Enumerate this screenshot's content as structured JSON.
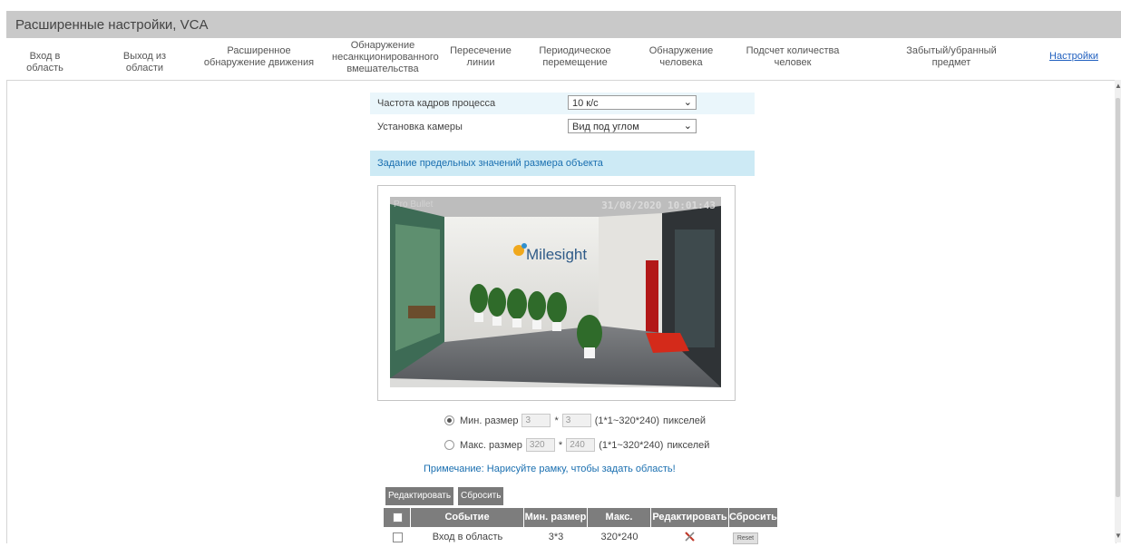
{
  "window": {
    "title": "Расширенные настройки, VCA"
  },
  "tabs": [
    {
      "label": "Вход в область"
    },
    {
      "label": "Выход из области"
    },
    {
      "label": "Расширенное обнаружение движения"
    },
    {
      "label": "Обнаружение несанкционированного вмешательства"
    },
    {
      "label": "Пересечение линии"
    },
    {
      "label": "Периодическое перемещение"
    },
    {
      "label": "Обнаружение человека"
    },
    {
      "label": "Подсчет количества человек"
    },
    {
      "label": "Забытый/убранный предмет"
    },
    {
      "label": "Настройки",
      "active": true
    }
  ],
  "settings": {
    "frame_rate": {
      "label": "Частота кадров процесса",
      "value": "10 к/с"
    },
    "camera_install": {
      "label": "Установка камеры",
      "value": "Вид под углом"
    }
  },
  "object_size": {
    "header": "Задание предельных значений размера объекта",
    "preview": {
      "osd_name": "Pro Bullet",
      "osd_time": "31/08/2020 10:01:43",
      "brand": "Milesight"
    },
    "min": {
      "label": "Мин. размер",
      "w": "3",
      "h": "3",
      "range": "(1*1~320*240)",
      "unit": "пикселей",
      "selected": true
    },
    "max": {
      "label": "Макс. размер",
      "w": "320",
      "h": "240",
      "range": "(1*1~320*240)",
      "unit": "пикселей",
      "selected": false
    },
    "note": "Примечание: Нарисуйте рамку, чтобы задать область!"
  },
  "actions": {
    "edit": "Редактировать",
    "reset": "Сбросить"
  },
  "table": {
    "headers": [
      "Событие",
      "Мин. размер",
      "Макс. размер",
      "Редактировать",
      "Сбросить"
    ],
    "rows": [
      {
        "event": "Вход в область",
        "min": "3*3",
        "max": "320*240",
        "reset": "Reset"
      }
    ]
  },
  "colors": {
    "accent": "#1a6fb0",
    "header_bg": "#c9c9c9",
    "section_bg": "#cdeaf5",
    "button_bg": "#7a7a7a"
  }
}
